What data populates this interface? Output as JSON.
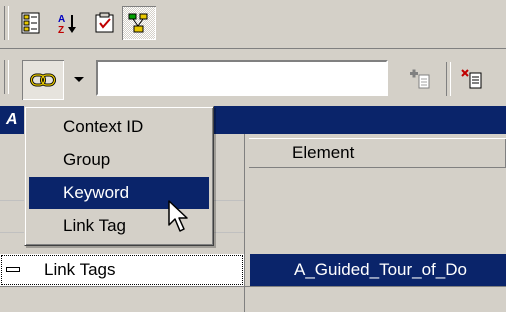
{
  "toolbar_top": {
    "buttons": [
      {
        "icon": "properties-icon"
      },
      {
        "icon": "sort-az-icon"
      },
      {
        "icon": "checklist-icon"
      },
      {
        "icon": "structure-icon",
        "pressed": true
      }
    ]
  },
  "toolbar_link": {
    "link_button_icon": "chain-link-icon",
    "dropdown_icon": "chevron-down-icon",
    "input_value": "",
    "add_icon": "add-link-icon",
    "remove_icon": "remove-link-icon"
  },
  "titlebar": {
    "label": "A"
  },
  "grid": {
    "column_header": "Element",
    "selected_row": {
      "label": "Link Tags",
      "element": "A_Guided_Tour_of_Do"
    }
  },
  "menu": {
    "items": [
      {
        "label": "Context ID",
        "selected": false
      },
      {
        "label": "Group",
        "selected": false
      },
      {
        "label": "Keyword",
        "selected": true
      },
      {
        "label": "Link Tag",
        "selected": false
      }
    ]
  },
  "colors": {
    "selection": "#0a246a",
    "face": "#d4d0c8"
  }
}
